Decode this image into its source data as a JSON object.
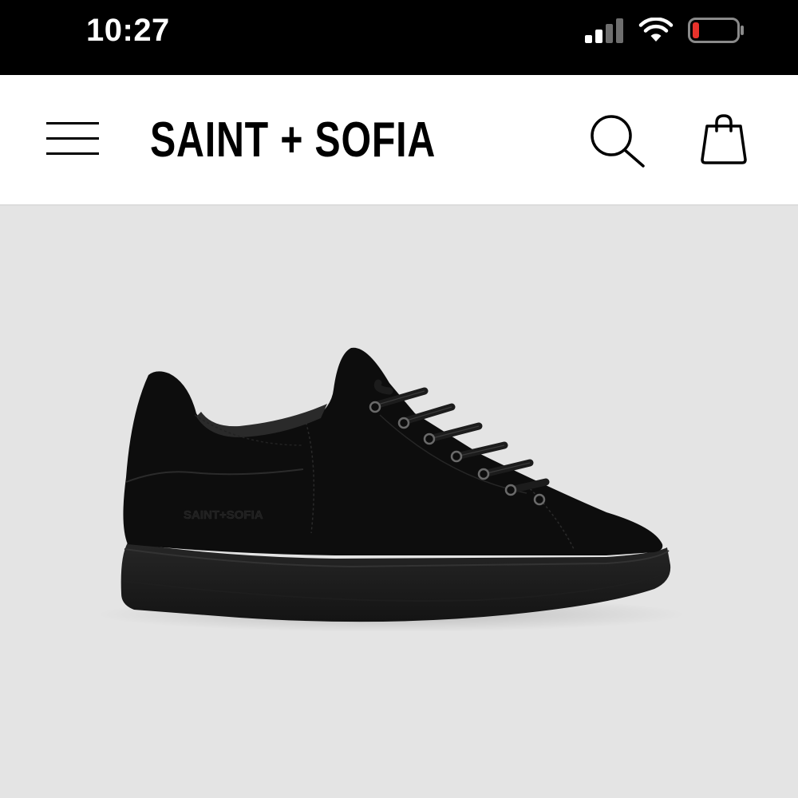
{
  "status_bar": {
    "time": "10:27",
    "icons": [
      "signal-icon",
      "wifi-icon",
      "battery-icon"
    ],
    "battery_color": "#e8322b"
  },
  "header": {
    "brand": "SAINT + SOFIA",
    "icons": [
      "menu-icon",
      "search-icon",
      "shopping-bag-icon"
    ]
  },
  "product": {
    "image": "black-suede-sneaker",
    "sole_emboss": "SAINT+SOFIA",
    "background_color": "#e4e4e4"
  }
}
